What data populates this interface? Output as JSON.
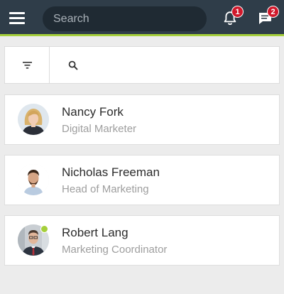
{
  "header": {
    "search_placeholder": "Search",
    "notifications_count": "1",
    "messages_count": "2",
    "accent_color": "#a5cf3b",
    "background_color": "#2f3d49",
    "badge_color": "#d1182b"
  },
  "toolbar": {
    "filter_icon": "filter-icon",
    "search_icon": "search-icon"
  },
  "contacts": [
    {
      "name": "Nancy Fork",
      "role": "Digital Marketer",
      "online": false
    },
    {
      "name": "Nicholas Freeman",
      "role": "Head of Marketing",
      "online": false
    },
    {
      "name": "Robert Lang",
      "role": "Marketing Coordinator",
      "online": true
    }
  ]
}
